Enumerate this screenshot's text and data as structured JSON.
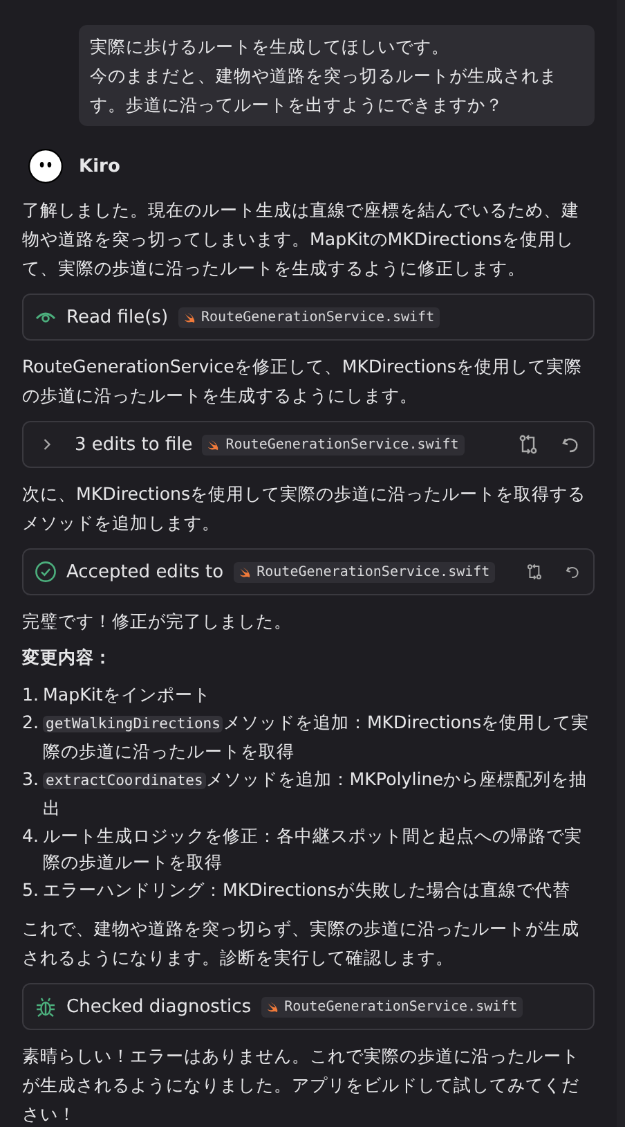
{
  "user_message": {
    "lines": [
      "実際に歩けるルートを生成してほしいです。",
      "今のままだと、建物や道路を突っ切るルートが生成されます。歩道に沿ってルートを出すようにできますか？"
    ]
  },
  "assistant": {
    "name": "Kiro"
  },
  "blocks": [
    {
      "kind": "paragraph",
      "text": "了解しました。現在のルート生成は直線で座標を結んでいるため、建物や道路を突っ切ってしまいます。MapKitのMKDirectionsを使用して、実際の歩道に沿ったルートを生成するように修正します。"
    },
    {
      "kind": "read",
      "label": "Read file(s)",
      "file": "RouteGenerationService.swift",
      "actions": false
    },
    {
      "kind": "paragraph",
      "text": "RouteGenerationServiceを修正して、MKDirectionsを使用して実際の歩道に沿ったルートを生成するようにします。"
    },
    {
      "kind": "edits",
      "expanded": false,
      "label": "3 edits to file",
      "file": "RouteGenerationService.swift",
      "actions": true
    },
    {
      "kind": "paragraph",
      "text": "次に、MKDirectionsを使用して実際の歩道に沿ったルートを取得するメソッドを追加します。"
    },
    {
      "kind": "accepted",
      "label": "Accepted edits to",
      "file": "RouteGenerationService.swift",
      "actions": true
    },
    {
      "kind": "paragraph",
      "text": "完璧です！修正が完了しました。"
    },
    {
      "kind": "heading",
      "text": "変更内容："
    },
    {
      "kind": "list",
      "items": [
        {
          "number": "1.",
          "text": "MapKitをインポート"
        },
        {
          "number": "2.",
          "code": "getWalkingDirections",
          "text": "メソッドを追加：MKDirectionsを使用して実際の歩道に沿ったルートを取得"
        },
        {
          "number": "3.",
          "code": "extractCoordinates",
          "text": "メソッドを追加：MKPolylineから座標配列を抽出"
        },
        {
          "number": "4.",
          "text": "ルート生成ロジックを修正：各中継スポット間と起点への帰路で実際の歩道ルートを取得"
        },
        {
          "number": "5.",
          "text": "エラーハンドリング：MKDirectionsが失敗した場合は直線で代替"
        }
      ]
    },
    {
      "kind": "paragraph",
      "text": "これで、建物や道路を突っ切らず、実際の歩道に沿ったルートが生成されるようになります。診断を実行して確認します。"
    },
    {
      "kind": "diagnostics",
      "label": "Checked diagnostics",
      "file": "RouteGenerationService.swift",
      "actions": false
    },
    {
      "kind": "paragraph",
      "text": "素晴らしい！エラーはありません。これで実際の歩道に沿ったルートが生成されるようになりました。アプリをビルドして試してみてください！"
    }
  ]
}
